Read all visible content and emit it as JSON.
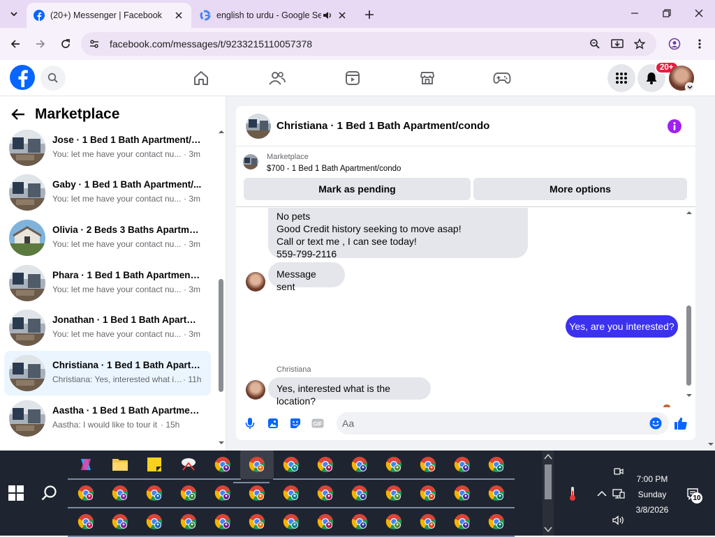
{
  "browser": {
    "tabs": [
      {
        "title": "(20+) Messenger | Facebook",
        "active": true
      },
      {
        "title": "english to urdu - Google Se",
        "active": false
      }
    ],
    "url": "facebook.com/messages/t/9233215110057378"
  },
  "fb_nav": {
    "notifications_badge": "20+"
  },
  "left_panel": {
    "title": "Marketplace",
    "conversations": [
      {
        "name": "Jose · 1 Bed 1 Bath Apartment/c...",
        "preview": "You: let me have your contact nu...",
        "time": "· 3m",
        "active": false
      },
      {
        "name": "Gaby · 1 Bed 1 Bath Apartment/...",
        "preview": "You: let me have your contact nu...",
        "time": "· 3m",
        "active": false
      },
      {
        "name": "Olivia · 2 Beds 3 Baths Apartme...",
        "preview": "You: let me have your contact nu...",
        "time": "· 3m",
        "active": false
      },
      {
        "name": "Phara · 1 Bed 1 Bath Apartment/...",
        "preview": "You: let me have your contact nu...",
        "time": "· 3m",
        "active": false
      },
      {
        "name": "Jonathan · 1 Bed 1 Bath Apartme...",
        "preview": "You: let me have your contact nu...",
        "time": "· 3m",
        "active": false
      },
      {
        "name": "Christiana · 1 Bed 1 Bath Apartm...",
        "preview": "Christiana: Yes, interested what is ...",
        "time": "· 11h",
        "active": true
      },
      {
        "name": "Aastha · 1 Bed 1 Bath Apartment...",
        "preview": "Aastha: I would like to tour it",
        "time": "· 15h",
        "active": false
      }
    ]
  },
  "chat": {
    "title": "Christiana · 1 Bed 1 Bath Apartment/condo",
    "marketplace_label": "Marketplace",
    "listing": "$700 - 1 Bed 1 Bath Apartment/condo",
    "mark_pending_label": "Mark as pending",
    "more_options_label": "More options",
    "messages": {
      "in_block_lines": [
        "No pets",
        "Good Credit history  seeking to move asap!",
        "Call or text me , I can see today!",
        "559-799-2116"
      ],
      "in_sent": "Message sent",
      "out_reply": "Yes, are you interested?",
      "sender_name": "Christiana",
      "in_reply": "Yes, interested what is the location?"
    },
    "composer_placeholder": "Aa"
  },
  "taskbar": {
    "time": "7:00 PM",
    "day": "Sunday",
    "date": "3/8/2026",
    "notification_count": "10"
  },
  "colors": {
    "fb_blue": "#0866ff",
    "outgoing_bubble": "#3b31ef",
    "active_conv_bg": "#ebf5ff",
    "info_purple": "#a020f0",
    "badge_red": "#e41e3f"
  }
}
